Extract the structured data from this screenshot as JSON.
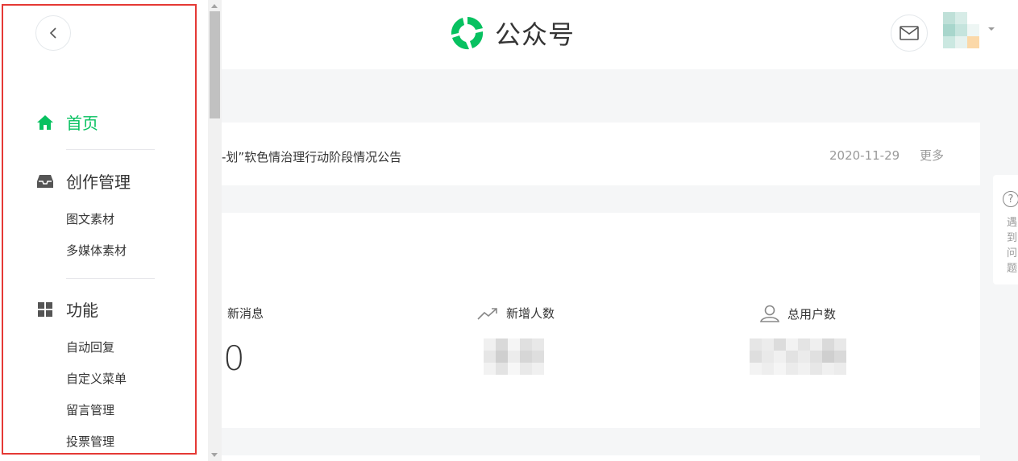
{
  "header": {
    "logo_text": "公众号",
    "brand_color": "#07c160"
  },
  "sidebar": {
    "back_icon": "chevron-left-icon",
    "sections": [
      {
        "label": "首页",
        "icon": "home-icon",
        "active": true,
        "items": []
      },
      {
        "label": "创作管理",
        "icon": "inbox-icon",
        "active": false,
        "items": [
          "图文素材",
          "多媒体素材"
        ]
      },
      {
        "label": "功能",
        "icon": "grid-icon",
        "active": false,
        "items": [
          "自动回复",
          "自定义菜单",
          "留言管理",
          "投票管理"
        ]
      }
    ]
  },
  "notice": {
    "text": "-划”软色情治理行动阶段情况公告",
    "date": "2020-11-29",
    "more": "更多"
  },
  "stats": {
    "new_messages_label": "新消息",
    "new_messages_value": "0",
    "new_followers_label": "新增人数",
    "total_users_label": "总用户数"
  },
  "help": {
    "text": "遇到问题"
  }
}
